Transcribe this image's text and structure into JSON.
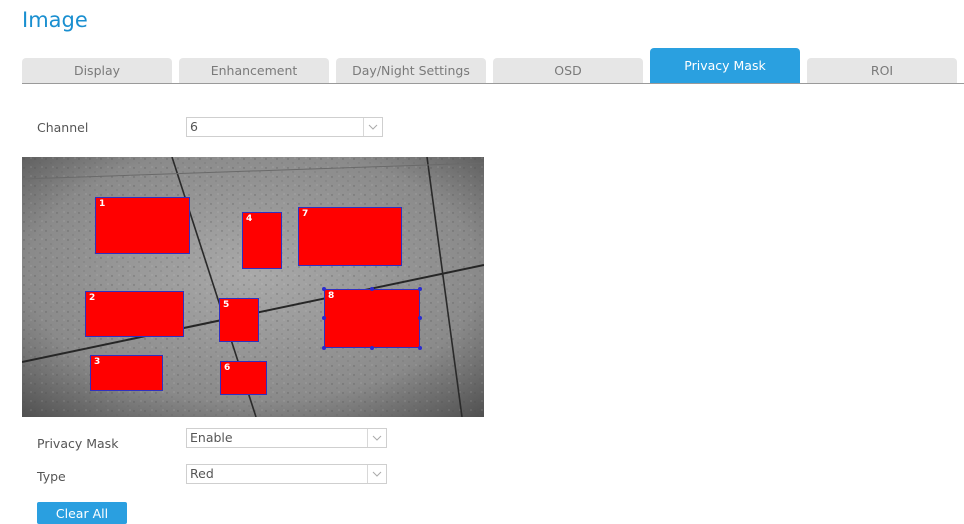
{
  "page": {
    "title": "Image"
  },
  "tabs": [
    {
      "label": "Display",
      "active": false
    },
    {
      "label": "Enhancement",
      "active": false
    },
    {
      "label": "Day/Night Settings",
      "active": false
    },
    {
      "label": "OSD",
      "active": false
    },
    {
      "label": "Privacy Mask",
      "active": true
    },
    {
      "label": "ROI",
      "active": false
    }
  ],
  "channel": {
    "label": "Channel",
    "value": "6"
  },
  "privacy_mask": {
    "label": "Privacy Mask",
    "value": "Enable"
  },
  "type": {
    "label": "Type",
    "value": "Red"
  },
  "masks": [
    {
      "number": "1"
    },
    {
      "number": "2"
    },
    {
      "number": "3"
    },
    {
      "number": "4"
    },
    {
      "number": "5"
    },
    {
      "number": "6"
    },
    {
      "number": "7"
    },
    {
      "number": "8",
      "selected": true
    }
  ],
  "buttons": {
    "clear_all": "Clear All"
  },
  "colors": {
    "accent": "#2aa0e0",
    "mask": "#ff0000",
    "mask_border": "#3030c0"
  }
}
